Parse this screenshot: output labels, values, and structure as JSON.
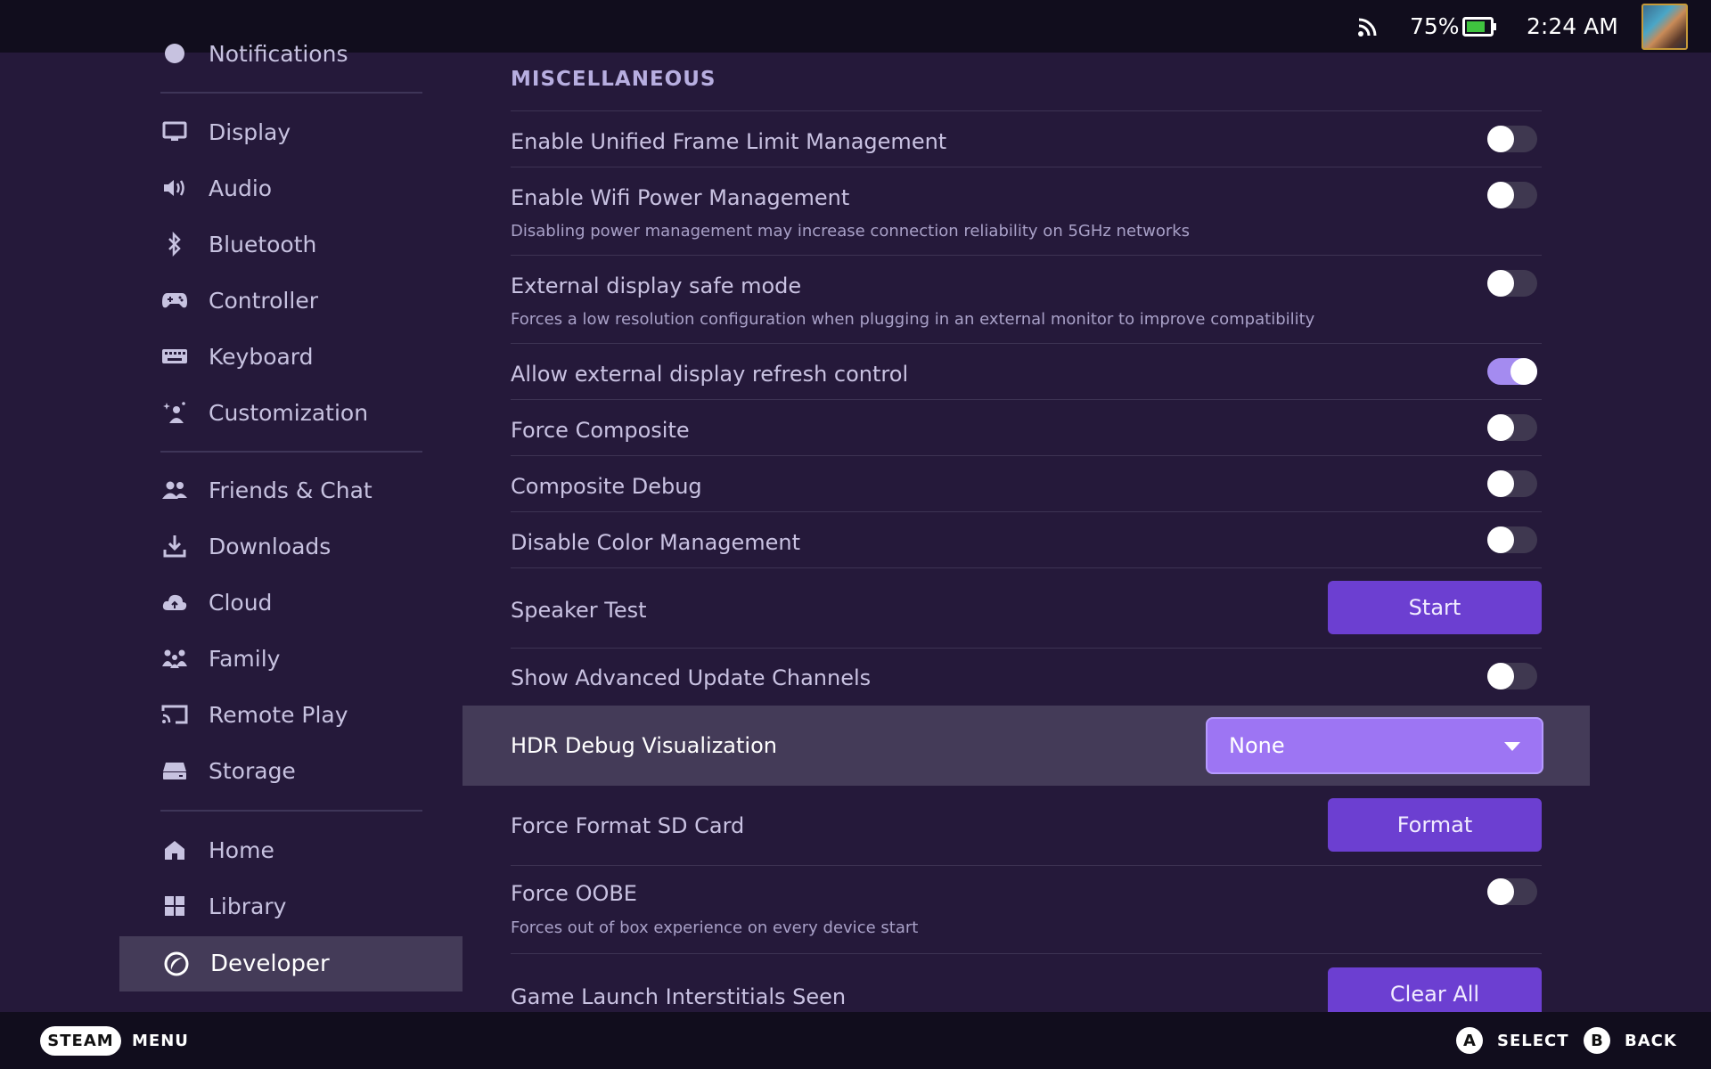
{
  "topbar": {
    "battery_percent": "75%",
    "battery_level": 0.75,
    "time": "2:24 AM",
    "icons": [
      "rss-icon",
      "battery-icon",
      "avatar"
    ]
  },
  "sidebar": {
    "items": [
      {
        "label": "Notifications",
        "icon": "bell-icon"
      },
      {
        "label": "Display",
        "icon": "monitor-icon"
      },
      {
        "label": "Audio",
        "icon": "speaker-icon"
      },
      {
        "label": "Bluetooth",
        "icon": "bluetooth-icon"
      },
      {
        "label": "Controller",
        "icon": "gamepad-icon"
      },
      {
        "label": "Keyboard",
        "icon": "keyboard-icon"
      },
      {
        "label": "Customization",
        "icon": "sparkle-person-icon"
      },
      {
        "label": "Friends & Chat",
        "icon": "friends-icon"
      },
      {
        "label": "Downloads",
        "icon": "download-icon"
      },
      {
        "label": "Cloud",
        "icon": "cloud-icon"
      },
      {
        "label": "Family",
        "icon": "family-icon"
      },
      {
        "label": "Remote Play",
        "icon": "cast-icon"
      },
      {
        "label": "Storage",
        "icon": "storage-icon"
      },
      {
        "label": "Home",
        "icon": "home-icon"
      },
      {
        "label": "Library",
        "icon": "grid-icon"
      },
      {
        "label": "Developer",
        "icon": "developer-icon",
        "active": true
      }
    ]
  },
  "content": {
    "section_title": "MISCELLANEOUS",
    "rows": [
      {
        "title": "Enable Unified Frame Limit Management",
        "toggle": false
      },
      {
        "title": "Enable Wifi Power Management",
        "desc": "Disabling power management may increase connection reliability on 5GHz networks",
        "toggle": false
      },
      {
        "title": "External display safe mode",
        "desc": "Forces a low resolution configuration when plugging in an external monitor to improve compatibility",
        "toggle": false
      },
      {
        "title": "Allow external display refresh control",
        "toggle": true
      },
      {
        "title": "Force Composite",
        "toggle": false
      },
      {
        "title": "Composite Debug",
        "toggle": false
      },
      {
        "title": "Disable Color Management",
        "toggle": false
      },
      {
        "title": "Speaker Test",
        "button": "Start"
      },
      {
        "title": "Show Advanced Update Channels",
        "toggle": false
      },
      {
        "title": "HDR Debug Visualization",
        "dropdown": "None"
      },
      {
        "title": "Force Format SD Card",
        "button": "Format"
      },
      {
        "title": "Force OOBE",
        "desc": "Forces out of box experience on every device start",
        "toggle": false
      },
      {
        "title": "Game Launch Interstitials Seen",
        "button": "Clear All"
      }
    ]
  },
  "bottombar": {
    "steam_label": "STEAM",
    "menu_label": "MENU",
    "a_glyph": "A",
    "select_label": "SELECT",
    "b_glyph": "B",
    "back_label": "BACK"
  },
  "colors": {
    "background": "#25193a",
    "bar": "#110d1d",
    "accent": "#6c3fd1",
    "toggle_on": "#a48bf0",
    "highlight": "#443b58"
  }
}
